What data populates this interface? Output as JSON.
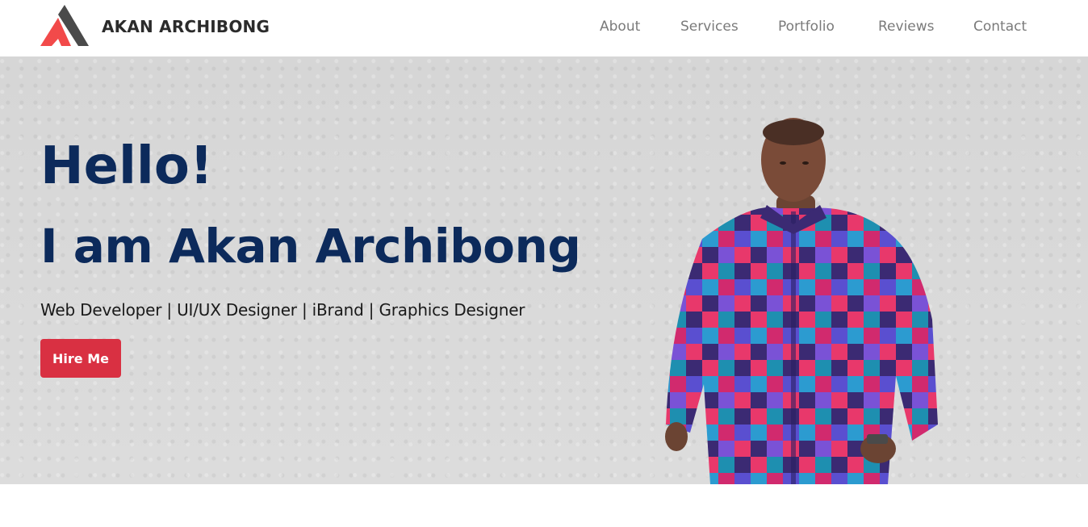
{
  "header": {
    "brand": "AKAN ARCHIBONG",
    "nav": [
      "About",
      "Services",
      "Portfolio",
      "Reviews",
      "Contact"
    ],
    "logo_colors": {
      "left": "#f24a4a",
      "right": "#4a4a4a"
    }
  },
  "hero": {
    "greeting": "Hello!",
    "intro": "I am Akan Archibong",
    "tagline": "Web Developer | UI/UX Designer | iBrand | Graphics Designer",
    "cta_label": "Hire Me",
    "heading_color": "#0c2a5b",
    "cta_color": "#d93042",
    "portrait_icon": "portrait-photo"
  }
}
